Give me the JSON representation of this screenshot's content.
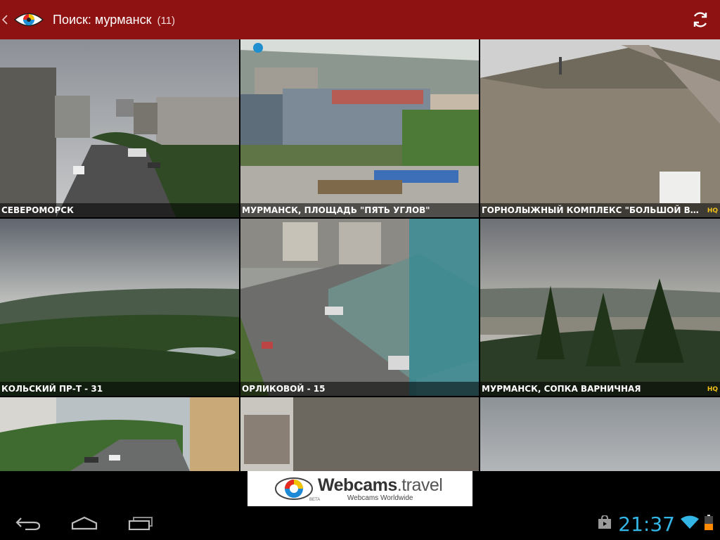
{
  "app": {
    "title": "Поиск: мурманск",
    "result_count": "(11)"
  },
  "icons": {
    "up": "chevron-left-icon",
    "logo": "eye-logo-icon",
    "refresh": "refresh-icon",
    "back": "back-icon",
    "home": "home-icon",
    "recents": "recent-apps-icon",
    "store": "shopping-bag-icon",
    "wifi": "wifi-icon",
    "battery": "battery-icon"
  },
  "colors": {
    "actionbar": "#8e1212",
    "hq_badge": "#f2c21a",
    "clock": "#33b5e5"
  },
  "webcams": [
    {
      "title": "СЕВЕРОМОРСК",
      "hq": ""
    },
    {
      "title": "МУРМАНСК,  ПЛОЩАДЬ \"ПЯТЬ УГЛОВ\"",
      "hq": ""
    },
    {
      "title": "ГОРНОЛЫЖНЫЙ КОМПЛЕКС \"БОЛЬШОЙ ВУД...",
      "hq": "HQ"
    },
    {
      "title": "КОЛЬСКИЙ ПР-Т - 31",
      "hq": ""
    },
    {
      "title": "ОРЛИКОВОЙ - 15",
      "hq": ""
    },
    {
      "title": "МУРМАНСК, СОПКА ВАРНИЧНАЯ",
      "hq": "HQ"
    },
    {
      "title": "",
      "hq": ""
    },
    {
      "title": "",
      "hq": ""
    },
    {
      "title": "",
      "hq": ""
    }
  ],
  "banner": {
    "brand_main": "Webcams",
    "brand_dot": ".travel",
    "tagline": "Webcams Worldwide",
    "beta": "BETA"
  },
  "status": {
    "time": "21:37"
  }
}
